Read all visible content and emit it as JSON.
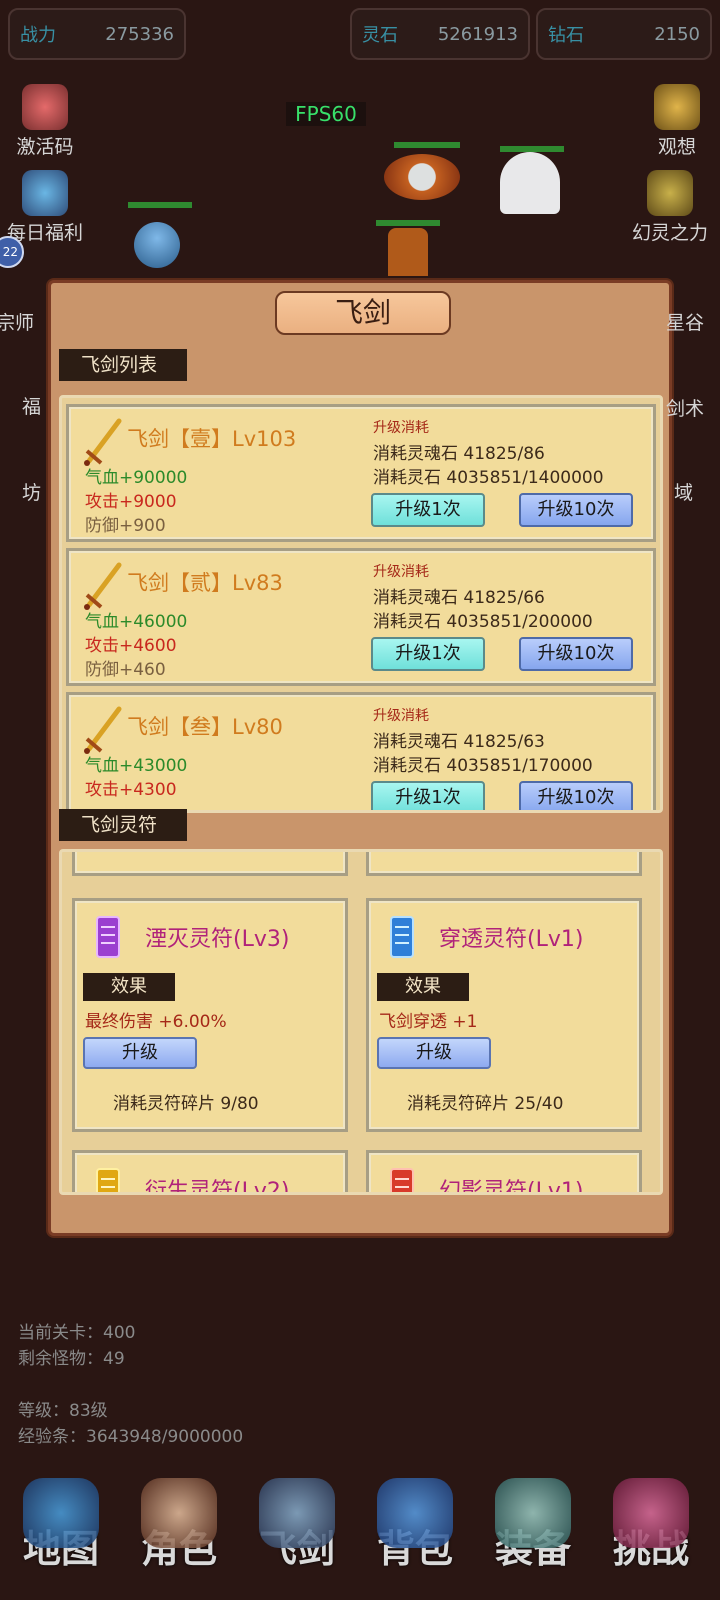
{
  "top_stats": [
    {
      "label": "战力",
      "value": "275336"
    },
    {
      "label": "灵石",
      "value": "5261913"
    },
    {
      "label": "钻石",
      "value": "2150"
    }
  ],
  "fps": "FPS60",
  "left_menu": [
    {
      "label": "激活码",
      "icon": "gift-icon"
    },
    {
      "label": "每日福利",
      "icon": "pot-icon"
    },
    {
      "label": "宗师",
      "icon": "scroll-icon"
    },
    {
      "label": "福",
      "icon": "orb-icon"
    },
    {
      "label": "坊",
      "icon": "shop-icon"
    }
  ],
  "right_menu": [
    {
      "label": "观想",
      "icon": "idol-icon"
    },
    {
      "label": "幻灵之力",
      "icon": "trophy-icon"
    },
    {
      "label": "星谷",
      "icon": "star-icon"
    },
    {
      "label": "剑术",
      "icon": "sword-skill-icon"
    },
    {
      "label": "域",
      "icon": "domain-icon"
    }
  ],
  "left_badge": "22",
  "modal": {
    "title": "飞剑",
    "list_tag": "飞剑列表",
    "talisman_tag": "飞剑灵符",
    "swords": [
      {
        "name": "飞剑【壹】Lv103",
        "hp": "气血+90000",
        "atk": "攻击+9000",
        "def": "防御+900",
        "cost_title": "升级消耗",
        "cost1": "消耗灵魂石 41825/86",
        "cost2": "消耗灵石 4035851/1400000",
        "btn_once": "升级1次",
        "btn_ten": "升级10次"
      },
      {
        "name": "飞剑【贰】Lv83",
        "hp": "气血+46000",
        "atk": "攻击+4600",
        "def": "防御+460",
        "cost_title": "升级消耗",
        "cost1": "消耗灵魂石 41825/66",
        "cost2": "消耗灵石 4035851/200000",
        "btn_once": "升级1次",
        "btn_ten": "升级10次"
      },
      {
        "name": "飞剑【叁】Lv80",
        "hp": "气血+43000",
        "atk": "攻击+4300",
        "def": "",
        "cost_title": "升级消耗",
        "cost1": "消耗灵魂石 41825/63",
        "cost2": "消耗灵石 4035851/170000",
        "btn_once": "升级1次",
        "btn_ten": "升级10次"
      }
    ],
    "talismans": [
      {
        "name": "湮灭灵符(Lv3)",
        "effect_tag": "效果",
        "effect": "最终伤害 +6.00%",
        "btn": "升级",
        "cost": "消耗灵符碎片 9/80",
        "color": "#9b3fd0"
      },
      {
        "name": "穿透灵符(Lv1)",
        "effect_tag": "效果",
        "effect": "飞剑穿透 +1",
        "btn": "升级",
        "cost": "消耗灵符碎片 25/40",
        "color": "#2f7fd8"
      },
      {
        "name": "衍生灵符(Lv2)",
        "color": "#e0a812"
      },
      {
        "name": "幻影灵符(Lv1)",
        "color": "#d83a2a"
      }
    ]
  },
  "info": {
    "stage": "当前关卡：400",
    "monsters": "剩余怪物：49",
    "level": "等级：83级",
    "exp": "经验条：3643948/9000000"
  },
  "nav": [
    "地图",
    "角色",
    "飞剑",
    "背包",
    "装备",
    "挑战"
  ]
}
